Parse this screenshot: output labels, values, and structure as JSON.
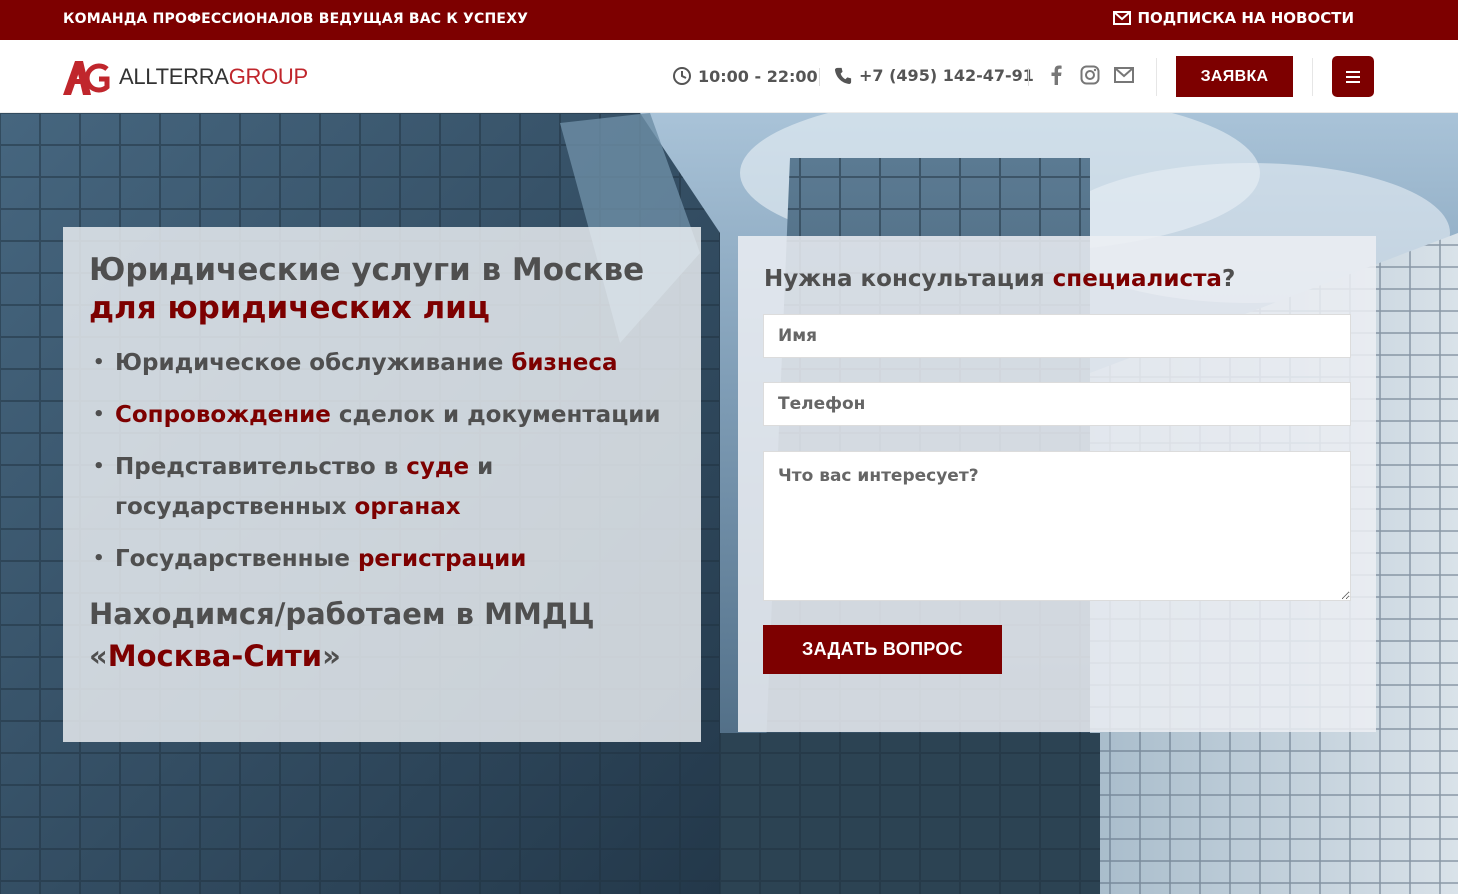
{
  "topbar": {
    "slogan": "КОМАНДА ПРОФЕССИОНАЛОВ ВЕДУЩАЯ ВАС К УСПЕХУ",
    "subscribe": "ПОДПИСКА НА НОВОСТИ",
    "subscribe_icon": "envelope-icon"
  },
  "header": {
    "logo_left": "ALLTERRA",
    "logo_right": "GROUP",
    "hours": "10:00 - 22:00",
    "phone": "+7 (495) 142-47-91",
    "social_icons": [
      "facebook-icon",
      "instagram-icon",
      "mail-icon"
    ],
    "request_button": "ЗАЯВКА",
    "menu_icon": "hamburger-icon"
  },
  "hero": {
    "title_part1": "Юридические услуги в Москве",
    "title_part2": "для юридических лиц",
    "services": [
      {
        "before": "Юридическое обслуживание ",
        "accent": "бизнеса",
        "after": ""
      },
      {
        "before": "",
        "accent": "Сопровождение",
        "after": " сделок и документации"
      },
      {
        "before": "Представительство в ",
        "accent": "суде",
        "mid": " и государственных ",
        "accent2": "органах"
      },
      {
        "before": "Государственные ",
        "accent": "регистрации",
        "after": ""
      }
    ],
    "location_before": "Находимся/работаем в ММДЦ «",
    "location_accent": "Москва-Сити",
    "location_after": "»"
  },
  "form": {
    "title_before": "Нужна консультация ",
    "title_accent": "специалиста",
    "title_after": "?",
    "name_placeholder": "Имя",
    "phone_placeholder": "Телефон",
    "message_placeholder": "Что вас интересует?",
    "submit": "ЗАДАТЬ ВОПРОС"
  },
  "colors": {
    "brand": "#7d0000",
    "logo_red": "#c0262c",
    "text": "#4f4f4f"
  }
}
